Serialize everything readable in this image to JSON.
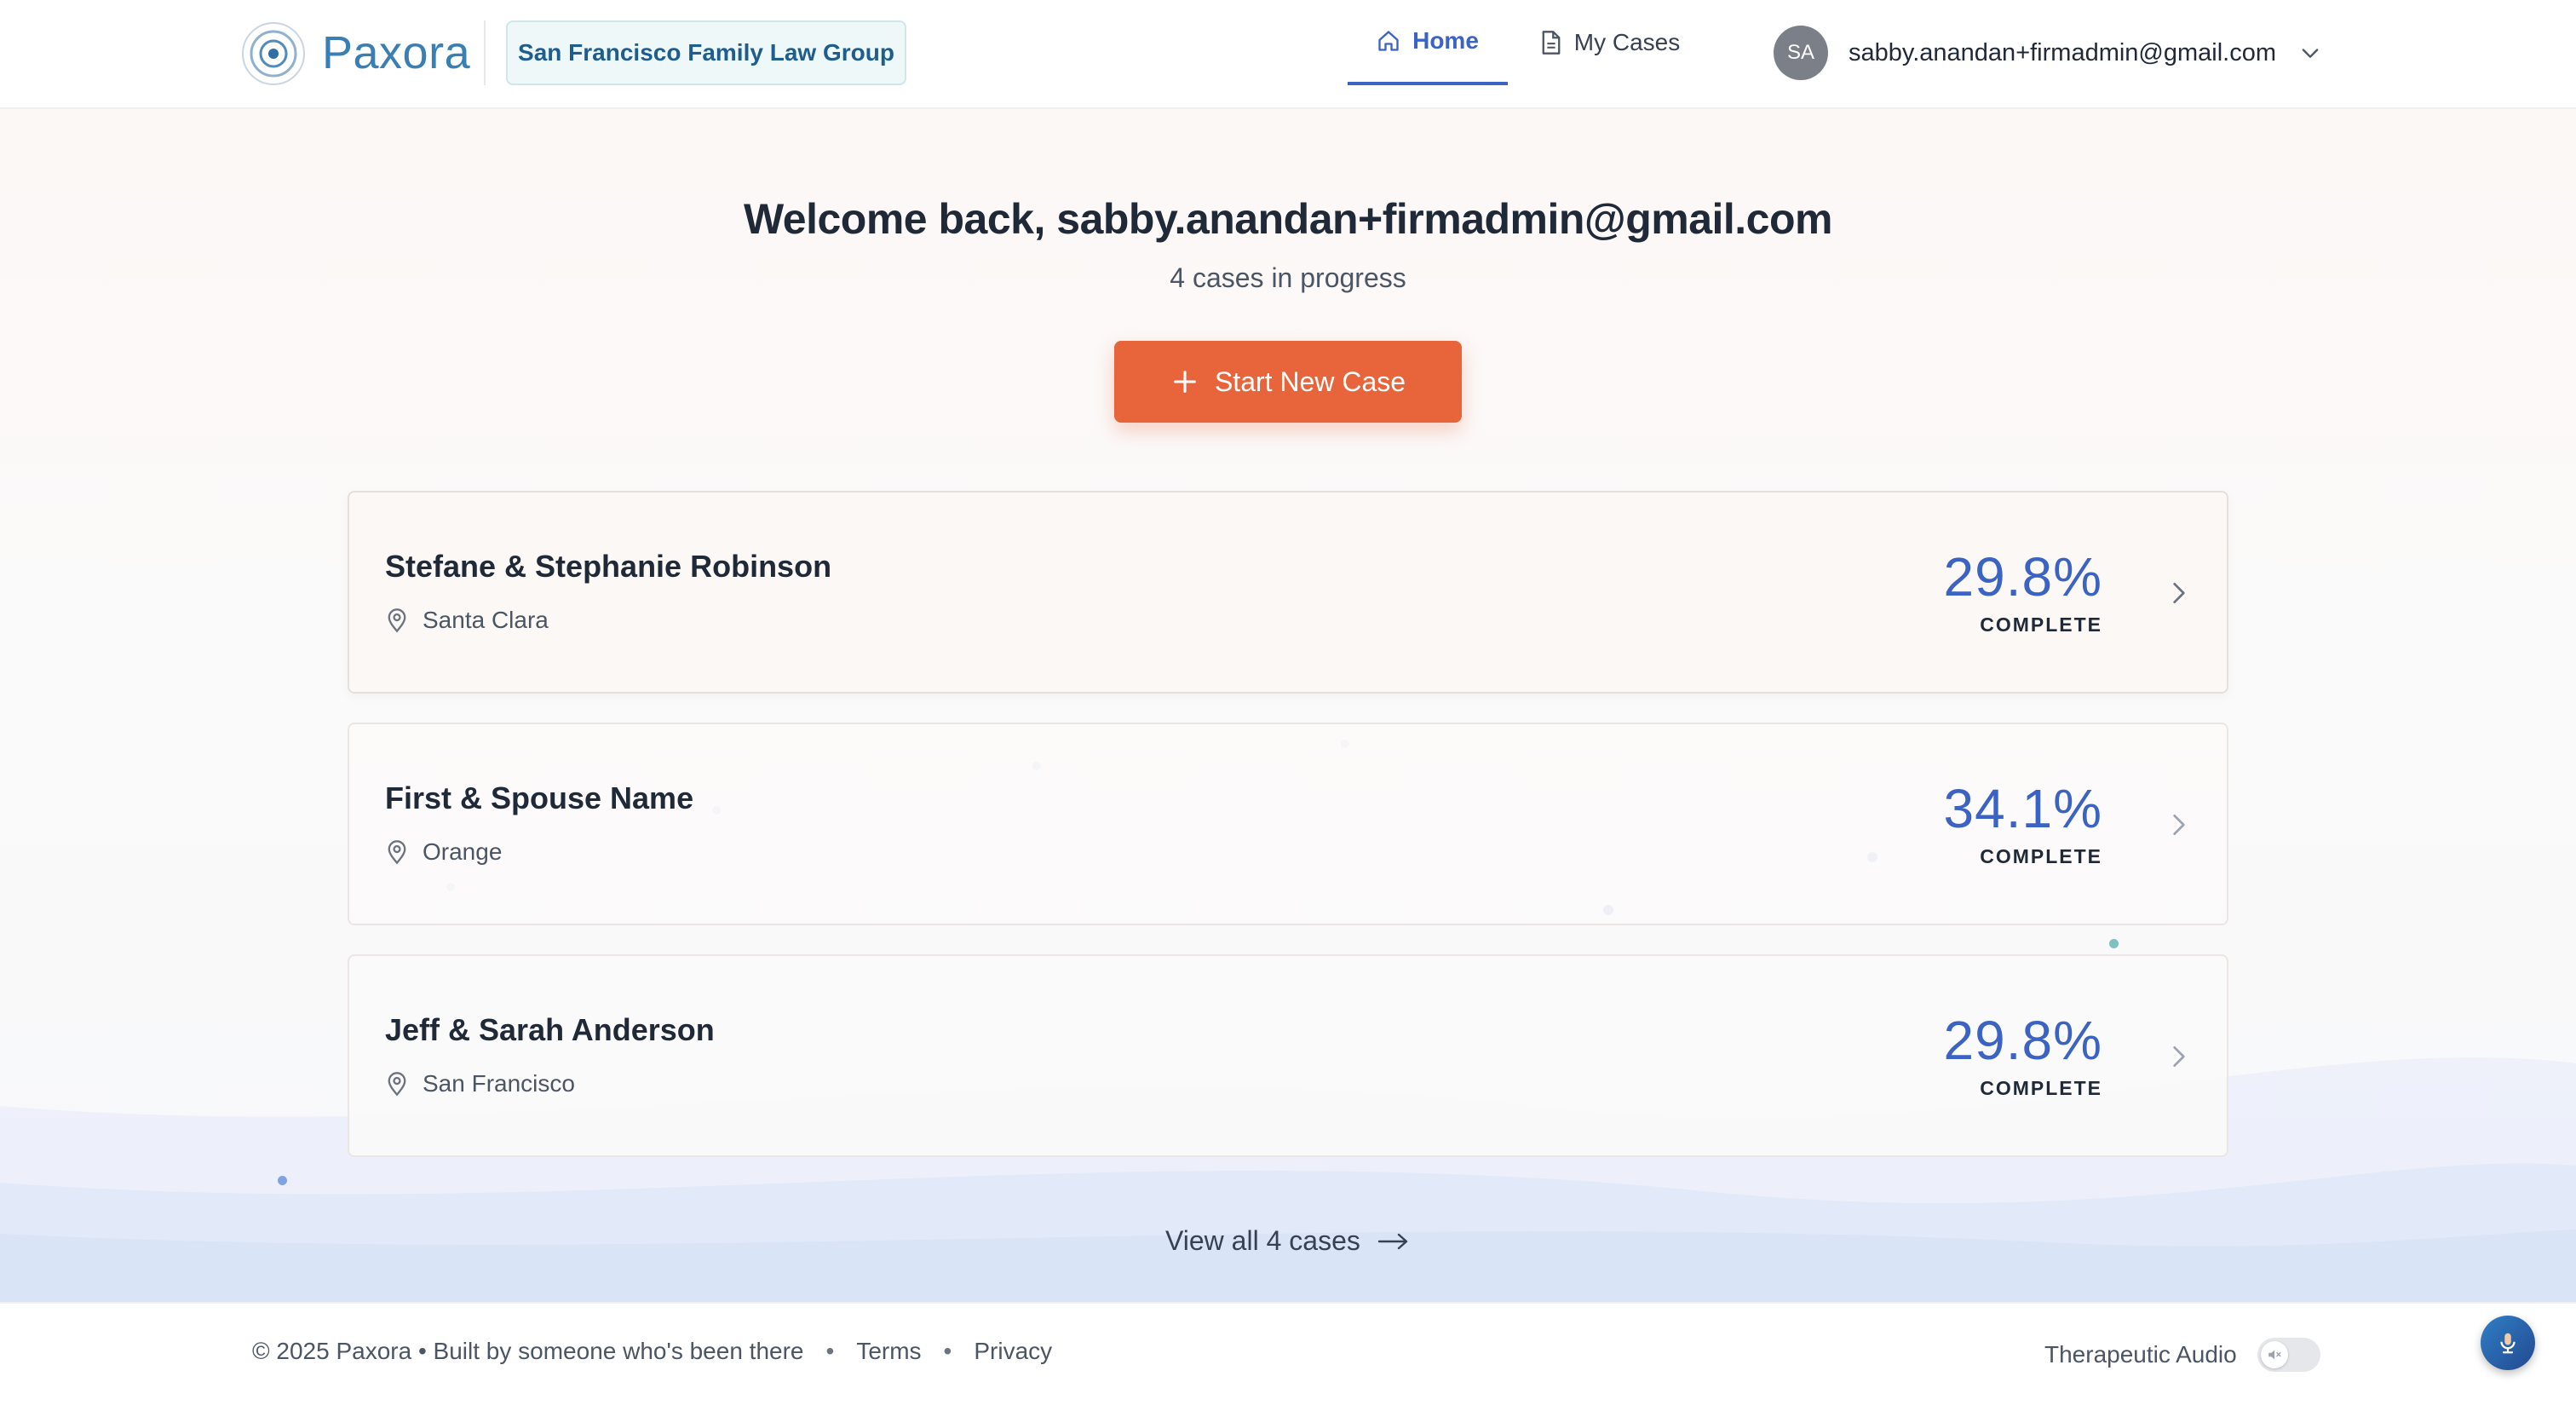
{
  "brand": {
    "name": "Paxora",
    "accent": "#3b63c4",
    "cta_color": "#e8643a"
  },
  "header": {
    "firm_name": "San Francisco Family Law Group",
    "nav": [
      {
        "label": "Home",
        "icon": "home-icon",
        "active": true
      },
      {
        "label": "My Cases",
        "icon": "document-icon",
        "active": false
      }
    ],
    "user": {
      "initials": "SA",
      "email": "sabby.anandan+firmadmin@gmail.com"
    }
  },
  "main": {
    "welcome": "Welcome back, sabby.anandan+firmadmin@gmail.com",
    "subtitle": "4 cases in progress",
    "new_case_label": "Start New Case",
    "cases": [
      {
        "name": "Stefane & Stephanie Robinson",
        "location": "Santa Clara",
        "percent": "29.8%",
        "complete_label": "COMPLETE"
      },
      {
        "name": "First & Spouse Name",
        "location": "Orange",
        "percent": "34.1%",
        "complete_label": "COMPLETE"
      },
      {
        "name": "Jeff & Sarah Anderson",
        "location": "San Francisco",
        "percent": "29.8%",
        "complete_label": "COMPLETE"
      }
    ],
    "view_all_label": "View all 4 cases"
  },
  "footer": {
    "copyright": "© 2025 Paxora • Built by someone who's been there",
    "links": [
      "Terms",
      "Privacy"
    ],
    "audio_label": "Therapeutic Audio",
    "audio_enabled": false
  }
}
